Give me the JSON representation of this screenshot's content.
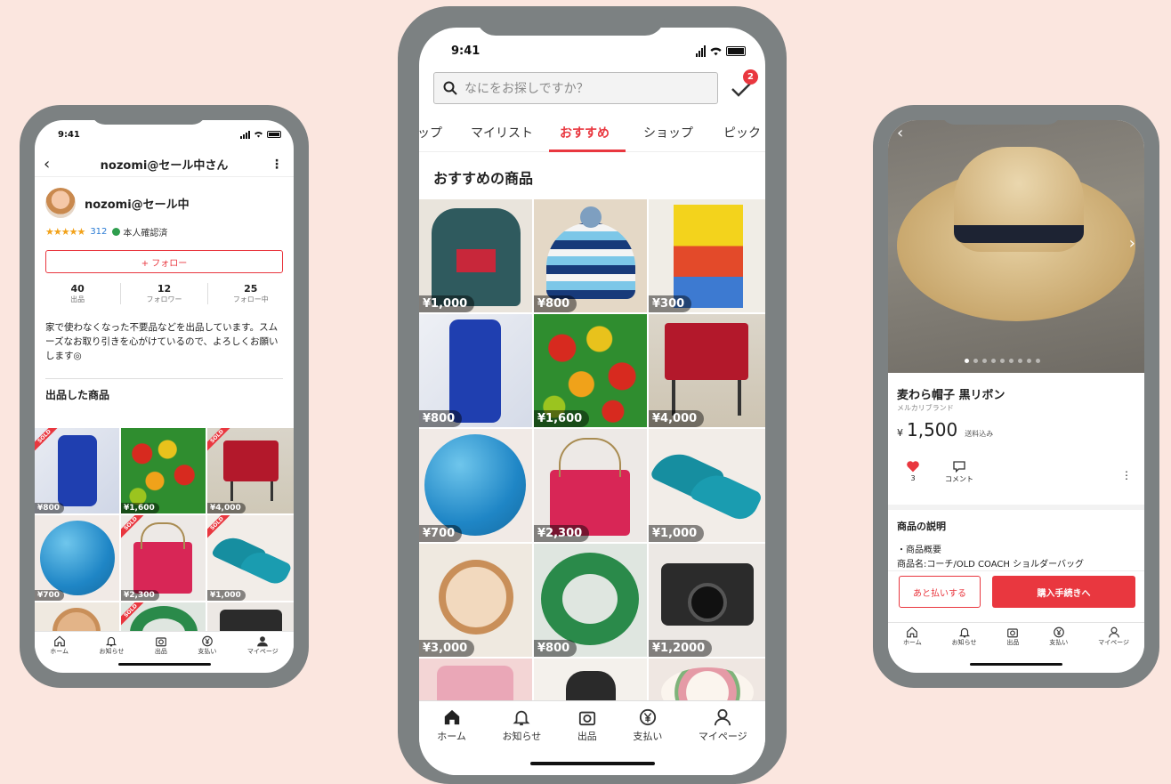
{
  "status_time": "9:41",
  "colors": {
    "accent": "#e9373f",
    "background": "#fbe6df",
    "phone_frame": "#7c8182"
  },
  "tabbar": [
    {
      "label": "ホーム",
      "icon": "home-icon"
    },
    {
      "label": "お知らせ",
      "icon": "bell-icon"
    },
    {
      "label": "出品",
      "icon": "camera-icon"
    },
    {
      "label": "支払い",
      "icon": "yen-icon"
    },
    {
      "label": "マイページ",
      "icon": "person-icon"
    }
  ],
  "profile": {
    "header_title": "nozomi@セール中さん",
    "name": "nozomi@セール中",
    "stars": "★★★★★",
    "rating_count": "312",
    "verified": "本人確認済",
    "follow_button": "+ フォロー",
    "stats": [
      {
        "value": "40",
        "label": "出品"
      },
      {
        "value": "12",
        "label": "フォロワー"
      },
      {
        "value": "25",
        "label": "フォロー中"
      }
    ],
    "bio": "家で使わなくなった不要品などを出品しています。スムーズなお取り引きを心がけているので、よろしくお願いします◎",
    "section_title": "出品した商品",
    "sold_label": "SOLD",
    "items": [
      {
        "price": "¥800",
        "sold": true,
        "icon": "phone-case-icon"
      },
      {
        "price": "¥1,600",
        "sold": false,
        "icon": "tomato-icon"
      },
      {
        "price": "¥4,000",
        "sold": true,
        "icon": "chair-icon"
      },
      {
        "price": "¥700",
        "sold": false,
        "icon": "ball-icon"
      },
      {
        "price": "¥2,300",
        "sold": true,
        "icon": "bag-icon"
      },
      {
        "price": "¥1,000",
        "sold": true,
        "icon": "heels-icon"
      },
      {
        "price": "",
        "sold": false,
        "icon": "watch-icon"
      },
      {
        "price": "",
        "sold": false,
        "icon": "float-icon"
      },
      {
        "price": "",
        "sold": false,
        "icon": "camera-product-icon"
      }
    ]
  },
  "feed": {
    "search_placeholder": "なにをお探しですか？",
    "todo_badge": "2",
    "tabs": [
      "ップ",
      "マイリスト",
      "おすすめ",
      "ショップ",
      "ピック"
    ],
    "section_title": "おすすめの商品",
    "items": [
      {
        "price": "¥1,000",
        "icon": "hoodie-icon"
      },
      {
        "price": "¥800",
        "icon": "beanie-icon"
      },
      {
        "price": "¥300",
        "icon": "book-icon"
      },
      {
        "price": "¥800",
        "icon": "phone-case-icon"
      },
      {
        "price": "¥1,600",
        "icon": "tomato-icon"
      },
      {
        "price": "¥4,000",
        "icon": "chair-icon"
      },
      {
        "price": "¥700",
        "icon": "ball-icon"
      },
      {
        "price": "¥2,300",
        "icon": "bag-icon"
      },
      {
        "price": "¥1,000",
        "icon": "heels-icon"
      },
      {
        "price": "¥3,000",
        "icon": "watch-icon"
      },
      {
        "price": "¥800",
        "icon": "float-icon"
      },
      {
        "price": "¥1,2000",
        "icon": "camera-product-icon"
      },
      {
        "price": "",
        "icon": "shirt-icon"
      },
      {
        "price": "",
        "icon": "kettle-icon"
      },
      {
        "price": "",
        "icon": "plate-icon"
      }
    ]
  },
  "product": {
    "title": "麦わら帽子 黒リボン",
    "brand": "メルカリブランド",
    "price_yen": "¥",
    "price": "1,500",
    "shipping": "送料込み",
    "likes": "3",
    "comment_label": "コメント",
    "desc_title": "商品の説明",
    "desc_line1": "・商品概要",
    "desc_line2": "商品名:コーチ/OLD COACH ショルダーバッグ",
    "pay_later": "あと払いする",
    "buy": "購入手続きへ"
  }
}
